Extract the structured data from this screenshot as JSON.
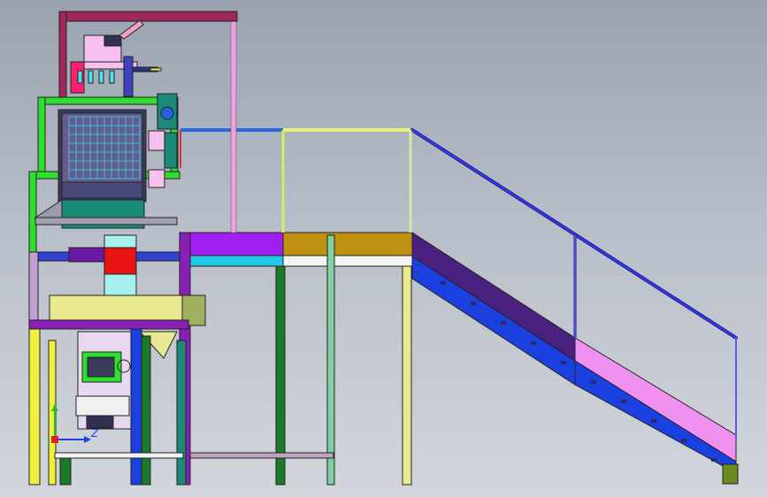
{
  "viewport": {
    "background": "gradient grey",
    "triad": {
      "z_label": "Z",
      "y_label": "Y"
    }
  },
  "colors": {
    "frame_green": "#2ee02e",
    "frame_purple": "#8a1fb5",
    "frame_magenta": "#a0285a",
    "rail_blue": "#2a2ad8",
    "rail_yellow": "#e8f07a",
    "platform_purple": "#a020f0",
    "platform_gold": "#c09010",
    "deck_cyan": "#22c8e8",
    "stair_purple": "#4a2080",
    "stair_blue": "#1a40e0",
    "stair_pink": "#f090f0",
    "hopper_teal": "#1a8a7a",
    "chute_red": "#e81414",
    "chute_cyan": "#a8f0f0",
    "beam_khaki": "#e8e890",
    "column_yellow": "#f0f040",
    "column_green": "#1a7a2a",
    "column_mint": "#80d0a0"
  },
  "components": [
    "top-frame",
    "weigh-hopper",
    "screen-cabinet",
    "discharge-hopper",
    "chute",
    "bagging-head",
    "platform",
    "handrail",
    "staircase",
    "support-columns",
    "coordinate-triad"
  ]
}
